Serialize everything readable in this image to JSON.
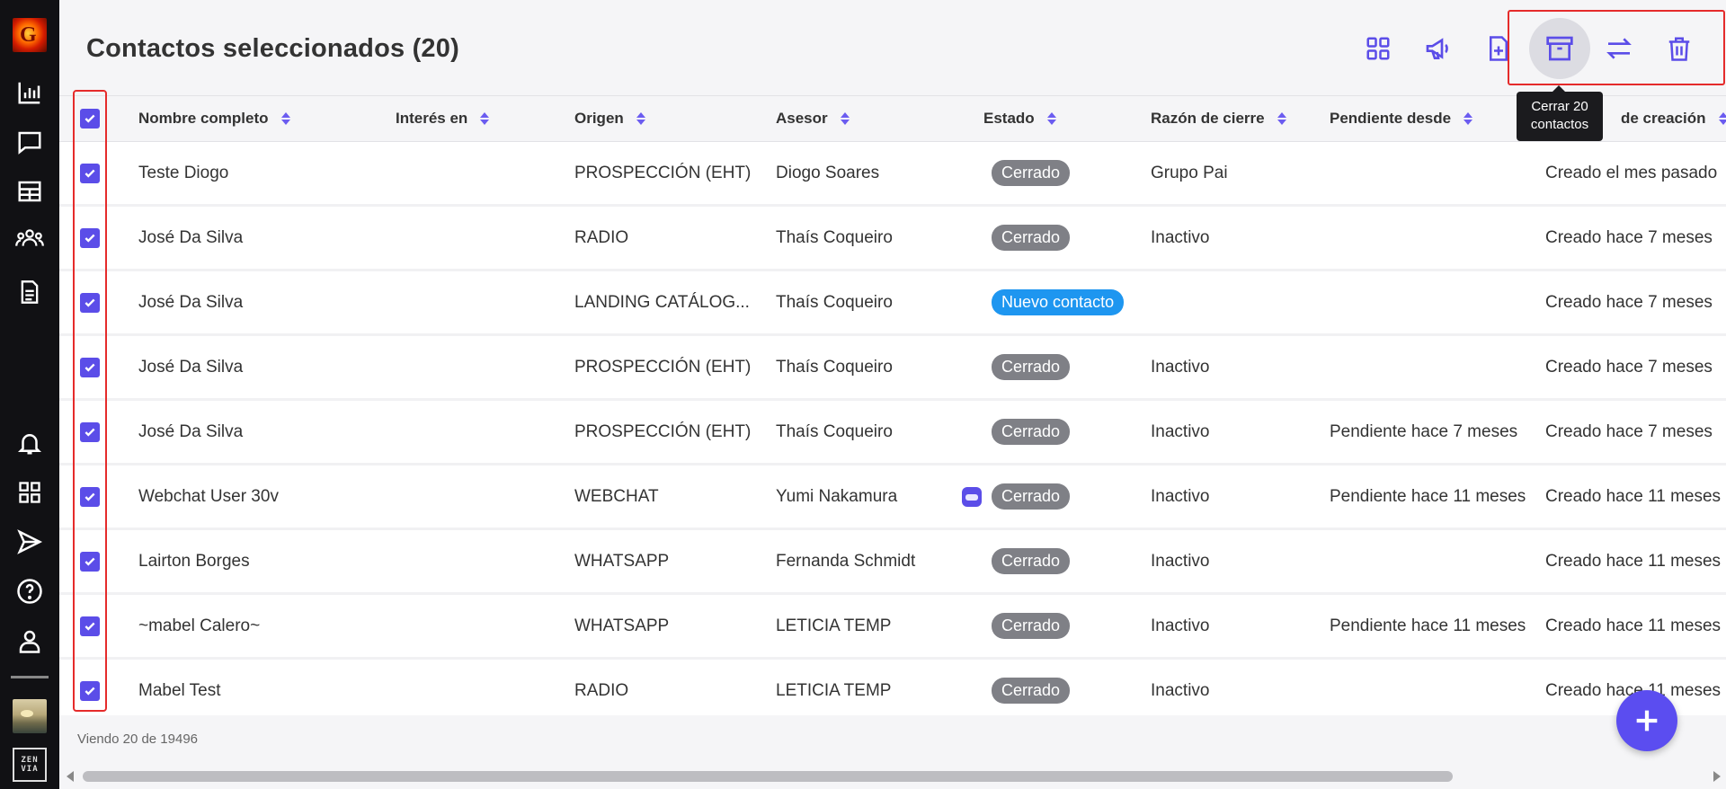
{
  "header": {
    "title": "Contactos seleccionados (20)",
    "tooltip": "Cerrar 20 contactos"
  },
  "toolbar": {
    "accent_color": "#5b4de8",
    "buttons": [
      {
        "icon": "grid-icon"
      },
      {
        "icon": "megaphone-icon"
      },
      {
        "icon": "file-add-icon"
      },
      {
        "icon": "archive-icon",
        "active": true
      },
      {
        "icon": "transfer-arrows-icon"
      },
      {
        "icon": "trash-icon"
      }
    ]
  },
  "sidebar": {
    "items": [
      "chart-icon",
      "chat-icon",
      "table-icon",
      "users-icon",
      "document-icon",
      "bell-icon",
      "apps-icon",
      "send-icon",
      "help-icon",
      "user-icon"
    ]
  },
  "table": {
    "columns": [
      "Nombre completo",
      "Interés en",
      "Origen",
      "Asesor",
      "Estado",
      "Razón de cierre",
      "Pendiente desde",
      "de creación"
    ],
    "rows": [
      {
        "name": "Teste Diogo",
        "interest": "",
        "origin": "PROSPECCIÓN (EHT)",
        "advisor": "Diogo Soares",
        "status": "Cerrado",
        "status_type": "closed",
        "reason": "Grupo Pai",
        "pending": "",
        "created": "Creado el mes pasado"
      },
      {
        "name": "José Da Silva",
        "interest": "",
        "origin": "RADIO",
        "advisor": "Thaís Coqueiro",
        "status": "Cerrado",
        "status_type": "closed",
        "reason": "Inactivo",
        "pending": "",
        "created": "Creado hace 7 meses"
      },
      {
        "name": "José Da Silva",
        "interest": "",
        "origin": "LANDING CATÁLOG...",
        "advisor": "Thaís Coqueiro",
        "status": "Nuevo contacto",
        "status_type": "new",
        "reason": "",
        "pending": "",
        "created": "Creado hace 7 meses"
      },
      {
        "name": "José Da Silva",
        "interest": "",
        "origin": "PROSPECCIÓN (EHT)",
        "advisor": "Thaís Coqueiro",
        "status": "Cerrado",
        "status_type": "closed",
        "reason": "Inactivo",
        "pending": "",
        "created": "Creado hace 7 meses"
      },
      {
        "name": "José Da Silva",
        "interest": "",
        "origin": "PROSPECCIÓN (EHT)",
        "advisor": "Thaís Coqueiro",
        "status": "Cerrado",
        "status_type": "closed",
        "reason": "Inactivo",
        "pending": "Pendiente hace 7 meses",
        "created": "Creado hace 7 meses"
      },
      {
        "name": "Webchat User 30v",
        "interest": "",
        "origin": "WEBCHAT",
        "advisor": "Yumi Nakamura",
        "advisor_bot": true,
        "status": "Cerrado",
        "status_type": "closed",
        "reason": "Inactivo",
        "pending": "Pendiente hace 11 meses",
        "created": "Creado hace 11 meses"
      },
      {
        "name": "Lairton Borges",
        "interest": "",
        "origin": "WHATSAPP",
        "advisor": "Fernanda Schmidt",
        "status": "Cerrado",
        "status_type": "closed",
        "reason": "Inactivo",
        "pending": "",
        "created": "Creado hace 11 meses"
      },
      {
        "name": "~mabel Calero~",
        "interest": "",
        "origin": "WHATSAPP",
        "advisor": "LETICIA TEMP",
        "status": "Cerrado",
        "status_type": "closed",
        "reason": "Inactivo",
        "pending": "Pendiente hace 11 meses",
        "created": "Creado hace 11 meses"
      },
      {
        "name": "Mabel Test",
        "interest": "",
        "origin": "RADIO",
        "advisor": "LETICIA TEMP",
        "status": "Cerrado",
        "status_type": "closed",
        "reason": "Inactivo",
        "pending": "",
        "created": "Creado hace 11 meses"
      }
    ]
  },
  "footer": {
    "viewing": "Viendo 20 de 19496"
  }
}
